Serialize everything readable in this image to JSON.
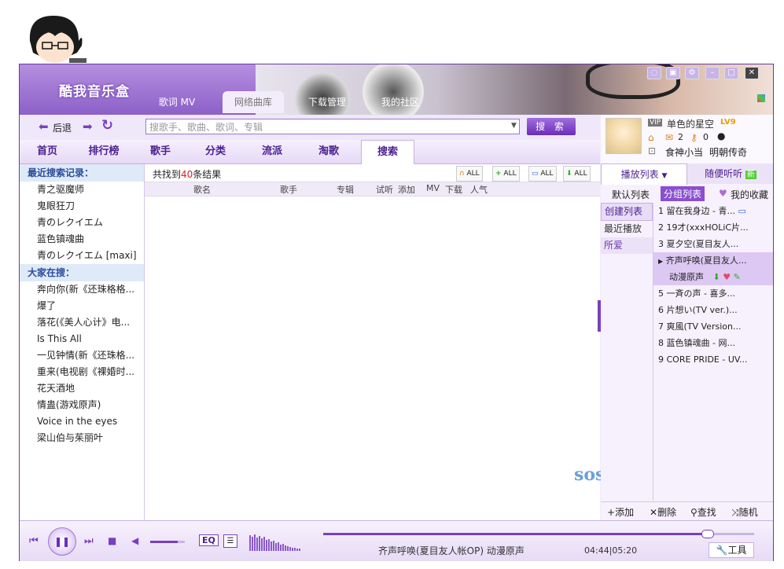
{
  "app": {
    "title": "酷我音乐盒"
  },
  "main_tabs": [
    {
      "label": "歌词 MV"
    },
    {
      "label": "网络曲库"
    },
    {
      "label": "下载管理"
    },
    {
      "label": "我的社区"
    }
  ],
  "nav": {
    "back_label": "后退",
    "search_placeholder": "搜歌手、歌曲、歌词、专辑",
    "search_button": "搜 索"
  },
  "category_tabs": [
    {
      "label": "首页"
    },
    {
      "label": "排行榜"
    },
    {
      "label": "歌手"
    },
    {
      "label": "分类"
    },
    {
      "label": "流派"
    },
    {
      "label": "淘歌"
    },
    {
      "label": "搜索"
    }
  ],
  "recent_searches": {
    "title": "最近搜索记录：",
    "items": [
      "青之驱魔师",
      "鬼眼狂刀",
      "青のレクイエム",
      "蓝色镇魂曲",
      "青のレクイエム [maxi]"
    ]
  },
  "popular_searches": {
    "title": "大家在搜：",
    "items": [
      "奔向你(新《还珠格格...",
      "爆了",
      "落花(《美人心计》电...",
      "Is This All",
      "一见钟情(新《还珠格...",
      "重来(电视剧《裸婚时...",
      "花天酒地",
      "情蛊(游戏原声)",
      "Voice in the eyes",
      "梁山伯与茱丽叶"
    ]
  },
  "results": {
    "prefix": "共找到",
    "count": "40",
    "suffix": "条结果",
    "columns": [
      "歌名",
      "歌手",
      "专辑",
      "试听",
      "添加",
      "MV",
      "下载",
      "人气"
    ],
    "all_label": "ALL"
  },
  "user": {
    "vip": "VIP",
    "name": "单色的星空",
    "level": "LV9",
    "mail_count": "2",
    "key_count": "0",
    "game_label": "食神小当",
    "game2_label": "明朝传奇"
  },
  "right_tabs": [
    {
      "label": "播放列表"
    },
    {
      "label": "随便听听"
    }
  ],
  "new_badge": "新",
  "sub_tabs": [
    "默认列表",
    "分组列表",
    "我的收藏"
  ],
  "playlists": [
    "创建列表",
    "最近播放",
    "所爱"
  ],
  "songs": [
    "1 留在我身边 - 青...",
    "2 19才(xxxHOLiC片...",
    "3 夏夕空(夏目友人...",
    "齐声呼唤(夏目友人...",
    "5 一斉の声 - 喜多...",
    "6 片想い(TV ver.)...",
    "7 爽風(TV Version...",
    "8 蓝色镇魂曲 - 网...",
    "9 CORE PRIDE - UV..."
  ],
  "active_song_sub": "动漫原声",
  "right_bottom": [
    {
      "label": "添加"
    },
    {
      "label": "删除"
    },
    {
      "label": "查找"
    },
    {
      "label": "随机"
    }
  ],
  "watermark": "sosg",
  "player": {
    "eq_label": "EQ",
    "now_playing": "齐声呼唤(夏目友人帐OP) 动漫原声",
    "time": "04:44|05:20",
    "progress": 0.89,
    "volume": 0.8,
    "tools_label": "工具"
  },
  "colors": {
    "accent": "#7a3fc0",
    "count_red": "#e02020"
  }
}
